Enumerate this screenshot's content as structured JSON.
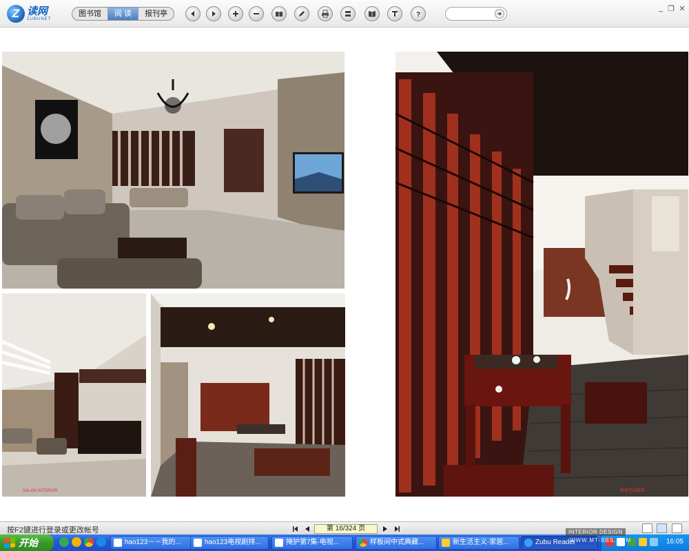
{
  "logo": {
    "mark": "Z",
    "cn": "读网",
    "en": "ZUBUNET"
  },
  "tabs": [
    {
      "label": "图书馆",
      "active": false
    },
    {
      "label": "阅 读",
      "active": true
    },
    {
      "label": "报刊亭",
      "active": false
    }
  ],
  "toolbar_icons": [
    "prev-page-icon",
    "next-page-icon",
    "zoom-in-icon",
    "zoom-out-icon",
    "bookshelf-icon",
    "pen-icon",
    "print-icon",
    "bookmark-icon",
    "book-view-icon",
    "text-icon",
    "help-icon"
  ],
  "search": {
    "value": "",
    "placeholder": ""
  },
  "window": {
    "minimize": "_",
    "restore": "❐",
    "close": "✕"
  },
  "pages": {
    "left_caption": "SALON INTERIOR",
    "right_caption": "家居空间装饰"
  },
  "status": {
    "hint": "按F2键进行登录或更改帐号",
    "page_indicator": "第 16/324 页"
  },
  "taskbar": {
    "start_label": "开始",
    "tasks": [
      {
        "label": "hao123－－我的..."
      },
      {
        "label": "hao123电视剧排..."
      },
      {
        "label": "掩护第7集-电视..."
      },
      {
        "label": "样板间中式典藏..."
      },
      {
        "label": "新生活主义-家居..."
      },
      {
        "label": "Zubu Reader"
      }
    ],
    "clock": "16:05"
  },
  "watermark": {
    "line1": "INTERIOR DESIGN",
    "line2": "WWW.MT-BBS.COM"
  },
  "colors": {
    "accent": "#4c7dc4",
    "taskbar": "#2458d6",
    "start": "#379a2a",
    "caption_red": "#d9383a"
  }
}
